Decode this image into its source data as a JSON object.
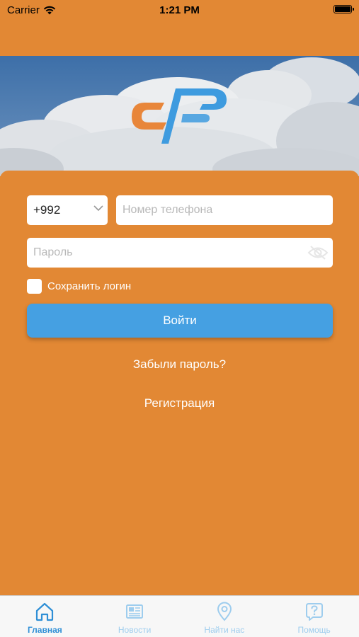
{
  "status_bar": {
    "carrier": "Carrier",
    "time": "1:21 PM"
  },
  "login": {
    "country_code": "+992",
    "phone_placeholder": "Номер телефона",
    "password_placeholder": "Пароль",
    "remember_label": "Сохранить логин",
    "login_button": "Войти",
    "forgot_password": "Забыли пароль?",
    "register": "Регистрация"
  },
  "tabs": [
    {
      "label": "Главная",
      "icon": "home-icon",
      "active": true
    },
    {
      "label": "Новости",
      "icon": "newspaper-icon",
      "active": false
    },
    {
      "label": "Найти нас",
      "icon": "map-pin-icon",
      "active": false
    },
    {
      "label": "Помощь",
      "icon": "help-icon",
      "active": false
    }
  ],
  "colors": {
    "background": "#E28834",
    "button": "#45A0E2",
    "tab_active": "#2F8FD6",
    "tab_inactive": "#9ECDEE"
  }
}
